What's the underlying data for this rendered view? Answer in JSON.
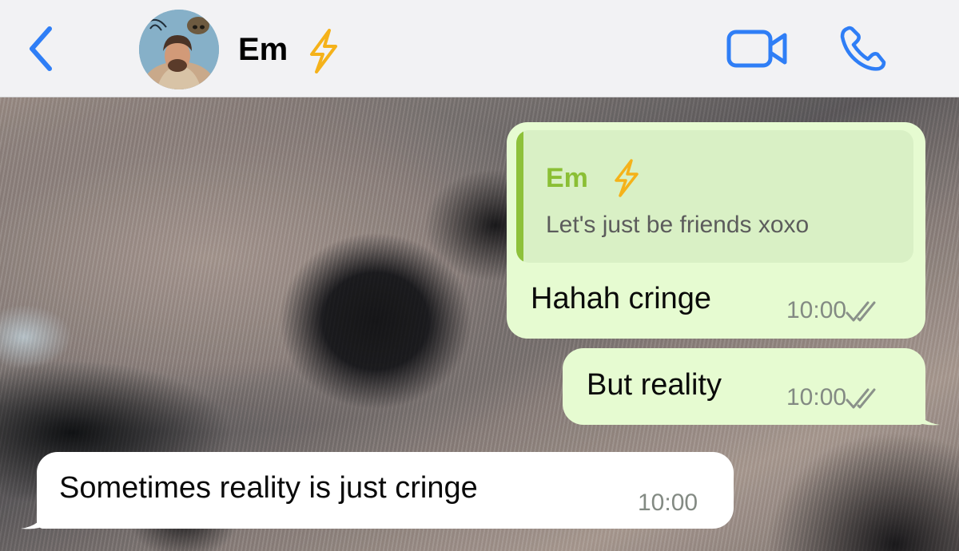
{
  "header": {
    "contact_name": "Em",
    "contact_emoji": "lightning-bolt-icon",
    "back_icon": "chevron-left-icon",
    "video_icon": "video-camera-icon",
    "call_icon": "phone-icon",
    "accent_color": "#2f7ef6"
  },
  "messages": [
    {
      "direction": "outgoing",
      "quoted": {
        "author": "Em",
        "author_emoji": "lightning-bolt-icon",
        "text": "Let's just be friends xoxo"
      },
      "text": "Hahah cringe",
      "time": "10:00",
      "status": "read-double-tick"
    },
    {
      "direction": "outgoing",
      "text": "But reality",
      "time": "10:00",
      "status": "read-double-tick"
    },
    {
      "direction": "incoming",
      "text": "Sometimes reality is just cringe",
      "time": "10:00"
    }
  ],
  "colors": {
    "outgoing_bubble": "#e6fbd1",
    "incoming_bubble": "#ffffff",
    "quote_bar": "#8ec13a",
    "quote_name": "#8bbf35",
    "bolt": "#f5b21a"
  }
}
